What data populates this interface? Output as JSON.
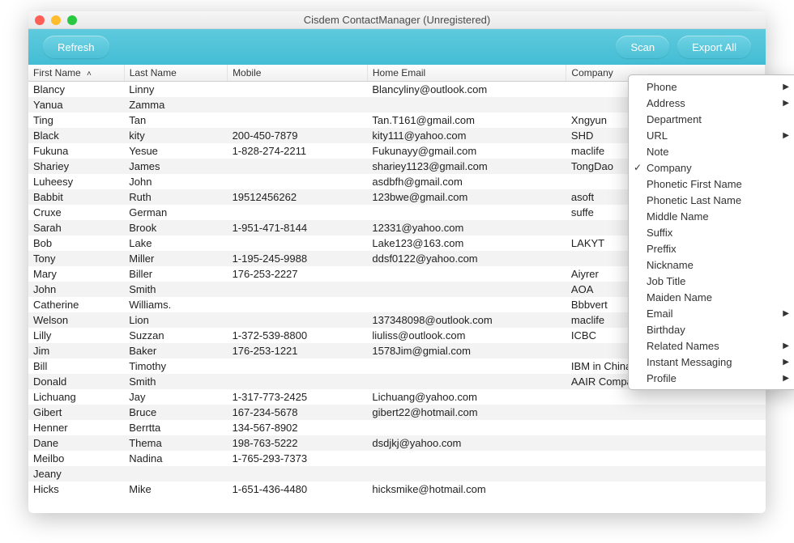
{
  "window": {
    "title": "Cisdem ContactManager (Unregistered)"
  },
  "toolbar": {
    "refresh_label": "Refresh",
    "scan_label": "Scan",
    "export_label": "Export All"
  },
  "columns": {
    "first": "First Name",
    "last": "Last Name",
    "mobile": "Mobile",
    "email": "Home Email",
    "company": "Company"
  },
  "rows": [
    {
      "f": "Blancy",
      "l": "Linny",
      "m": "",
      "e": "Blancyliny@outlook.com",
      "c": ""
    },
    {
      "f": "Yanua",
      "l": "Zamma",
      "m": "",
      "e": "",
      "c": ""
    },
    {
      "f": "Ting",
      "l": "Tan",
      "m": "",
      "e": "Tan.T161@gmail.com",
      "c": "Xngyun"
    },
    {
      "f": "Black",
      "l": "kity",
      "m": "200-450-7879",
      "e": "kity111@yahoo.com",
      "c": "SHD"
    },
    {
      "f": "Fukuna",
      "l": "Yesue",
      "m": "1-828-274-2211",
      "e": "Fukunayy@gmail.com",
      "c": "maclife"
    },
    {
      "f": "Shariey",
      "l": "James",
      "m": "",
      "e": "shariey1123@gmail.com",
      "c": "TongDao"
    },
    {
      "f": "Luheesy",
      "l": "John",
      "m": "",
      "e": "asdbfh@gmail.com",
      "c": ""
    },
    {
      "f": "Babbit",
      "l": "Ruth",
      "m": "19512456262",
      "e": "123bwe@gmail.com",
      "c": "asoft"
    },
    {
      "f": "Cruxe",
      "l": "German",
      "m": "",
      "e": "",
      "c": "suffe"
    },
    {
      "f": "Sarah",
      "l": "Brook",
      "m": "1-951-471-8144",
      "e": "12331@yahoo.com",
      "c": ""
    },
    {
      "f": "Bob",
      "l": "Lake",
      "m": "",
      "e": "Lake123@163.com",
      "c": "LAKYT"
    },
    {
      "f": "Tony",
      "l": "Miller",
      "m": "1-195-245-9988",
      "e": "ddsf0122@yahoo.com",
      "c": ""
    },
    {
      "f": "Mary",
      "l": "Biller",
      "m": "176-253-2227",
      "e": "",
      "c": "Aiyrer"
    },
    {
      "f": "John",
      "l": "Smith",
      "m": "",
      "e": "",
      "c": "AOA"
    },
    {
      "f": "Catherine",
      "l": "Williams.",
      "m": "",
      "e": "",
      "c": "Bbbvert"
    },
    {
      "f": "Welson",
      "l": "Lion",
      "m": "",
      "e": "137348098@outlook.com",
      "c": "maclife"
    },
    {
      "f": "Lilly",
      "l": "Suzzan",
      "m": "1-372-539-8800",
      "e": "liuliss@outlook.com",
      "c": "ICBC"
    },
    {
      "f": "Jim",
      "l": "Baker",
      "m": "176-253-1221",
      "e": "1578Jim@gmial.com",
      "c": ""
    },
    {
      "f": "Bill",
      "l": "Timothy",
      "m": "",
      "e": "",
      "c": "IBM in China"
    },
    {
      "f": "Donald",
      "l": "Smith",
      "m": "",
      "e": "",
      "c": "AAIR Company"
    },
    {
      "f": "Lichuang",
      "l": "Jay",
      "m": "1-317-773-2425",
      "e": "Lichuang@yahoo.com",
      "c": ""
    },
    {
      "f": "Gibert",
      "l": "Bruce",
      "m": "167-234-5678",
      "e": "gibert22@hotmail.com",
      "c": ""
    },
    {
      "f": "Henner",
      "l": "Berrtta",
      "m": "134-567-8902",
      "e": "",
      "c": ""
    },
    {
      "f": "Dane",
      "l": "Thema",
      "m": "198-763-5222",
      "e": "dsdjkj@yahoo.com",
      "c": ""
    },
    {
      "f": "Meilbo",
      "l": "Nadina",
      "m": "1-765-293-7373",
      "e": "",
      "c": ""
    },
    {
      "f": "Jeany",
      "l": "",
      "m": "",
      "e": "",
      "c": ""
    },
    {
      "f": "Hicks",
      "l": "Mike",
      "m": "1-651-436-4480",
      "e": "hicksmike@hotmail.com",
      "c": ""
    }
  ],
  "menu": {
    "items": [
      {
        "label": "Phone",
        "submenu": true
      },
      {
        "label": "Address",
        "submenu": true
      },
      {
        "label": "Department"
      },
      {
        "label": "URL",
        "submenu": true
      },
      {
        "label": "Note"
      },
      {
        "label": "Company",
        "checked": true
      },
      {
        "label": "Phonetic First Name"
      },
      {
        "label": "Phonetic Last Name"
      },
      {
        "label": "Middle Name"
      },
      {
        "label": "Suffix"
      },
      {
        "label": "Preffix"
      },
      {
        "label": "Nickname"
      },
      {
        "label": "Job Title"
      },
      {
        "label": "Maiden Name"
      },
      {
        "label": "Email",
        "submenu": true
      },
      {
        "label": "Birthday"
      },
      {
        "label": "Related Names",
        "submenu": true
      },
      {
        "label": "Instant Messaging",
        "submenu": true
      },
      {
        "label": "Profile",
        "submenu": true
      }
    ]
  }
}
